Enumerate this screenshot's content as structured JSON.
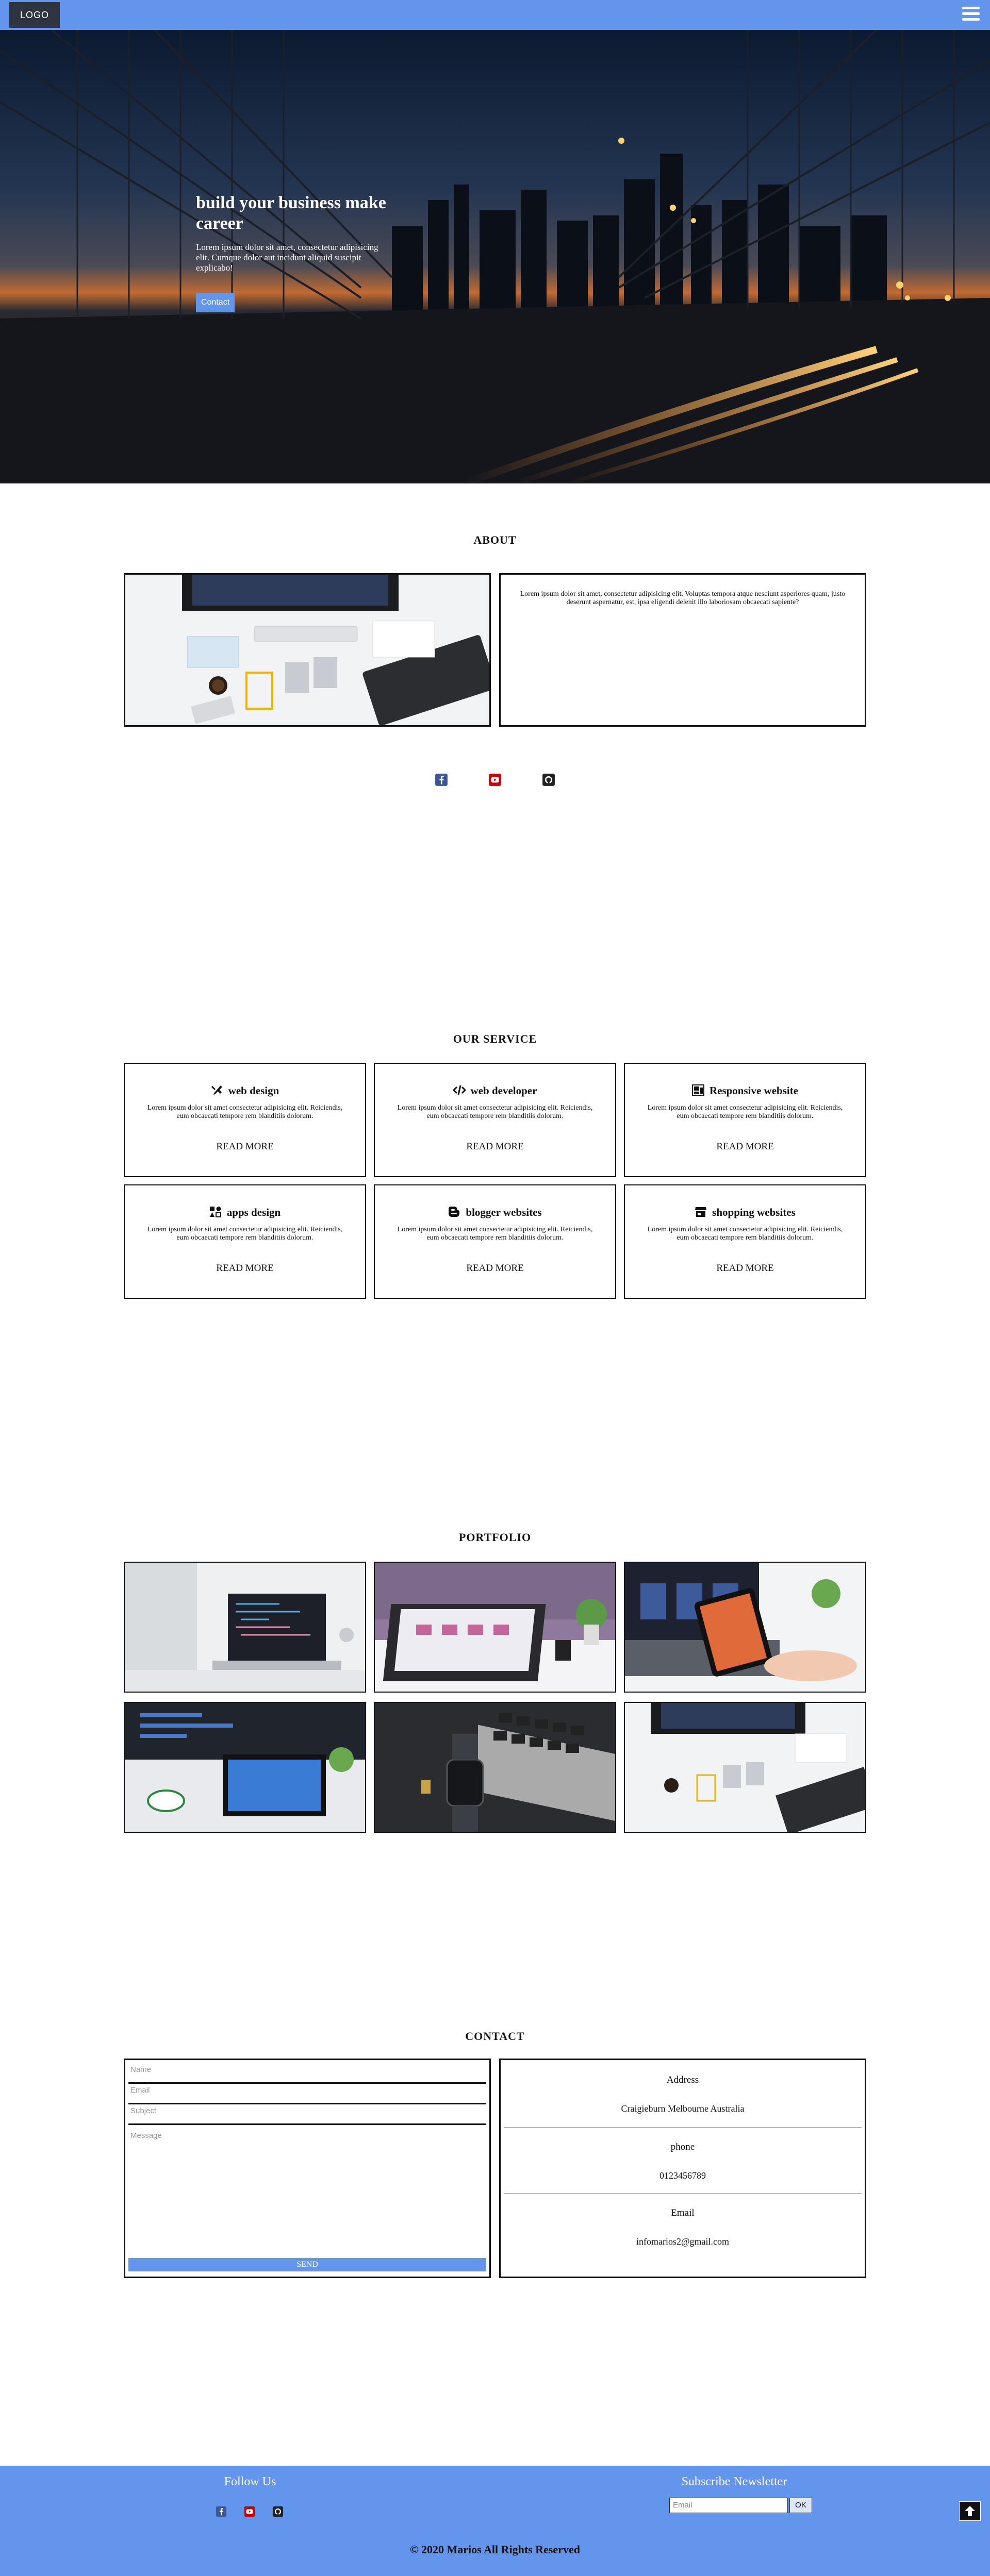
{
  "header": {
    "logo": "LOGO",
    "menu_icon": "hamburger-icon"
  },
  "hero": {
    "title": "build your business make career",
    "text": "Lorem ipsum dolor sit amet, consectetur adipisicing elit. Cumque dolor aut incidunt aliquid suscipit explicabo!",
    "button": "Contact"
  },
  "about": {
    "title": "ABOUT",
    "text": "Lorem ipsum dolor sit amet, consectetur adipisicing elit. Voluptas tempora atque nesciunt asperiores quam, justo deserunt aspernatur, est, ipsa eligendi delenit illo laboriosam obcaecati sapiente?",
    "social": [
      "facebook-icon",
      "youtube-icon",
      "github-icon"
    ]
  },
  "services": {
    "title": "OUR SERVICE",
    "items": [
      {
        "icon": "tools-icon",
        "title": "web design",
        "text": "Lorem ipsum dolor sit amet consectetur adipisicing elit. Reiciendis, eum obcaecati tempore rem blanditiis dolorum.",
        "more": "READ MORE"
      },
      {
        "icon": "code-icon",
        "title": "web developer",
        "text": "Lorem ipsum dolor sit amet consectetur adipisicing elit. Reiciendis, eum obcaecati tempore rem blanditiis dolorum.",
        "more": "READ MORE"
      },
      {
        "icon": "responsive-icon",
        "title": "Responsive website",
        "text": "Lorem ipsum dolor sit amet consectetur adipisicing elit. Reiciendis, eum obcaecati tempore rem blanditiis dolorum.",
        "more": "READ MORE"
      },
      {
        "icon": "apps-icon",
        "title": "apps design",
        "text": "Lorem ipsum dolor sit amet consectetur adipisicing elit. Reiciendis, eum obcaecati tempore rem blanditiis dolorum.",
        "more": "READ MORE"
      },
      {
        "icon": "blogger-icon",
        "title": "blogger websites",
        "text": "Lorem ipsum dolor sit amet consectetur adipisicing elit. Reiciendis, eum obcaecati tempore rem blanditiis dolorum.",
        "more": "READ MORE"
      },
      {
        "icon": "store-icon",
        "title": "shopping websites",
        "text": "Lorem ipsum dolor sit amet consectetur adipisicing elit. Reiciendis, eum obcaecati tempore rem blanditiis dolorum.",
        "more": "READ MORE"
      }
    ]
  },
  "portfolio": {
    "title": "PORTFOLIO"
  },
  "contact": {
    "title": "CONTACT",
    "form": {
      "name_placeholder": "Name",
      "email_placeholder": "Email",
      "subject_placeholder": "Subject",
      "message_placeholder": "Message",
      "send": "SEND"
    },
    "info": [
      {
        "label": "Address",
        "value": "Craigieburn Melbourne Australia"
      },
      {
        "label": "phone",
        "value": "0123456789"
      },
      {
        "label": "Email",
        "value": "infomarios2@gmail.com"
      }
    ]
  },
  "footer": {
    "follow": "Follow Us",
    "subscribe": "Subscribe Newsletter",
    "email_placeholder": "Email",
    "ok": "OK",
    "copyright": "© 2020 Marios All Rights Reserved",
    "to_top_icon": "arrow-up-icon"
  },
  "colors": {
    "accent": "#6495ed",
    "dark": "#111111",
    "facebook": "#3b5998",
    "youtube": "#cc0000"
  }
}
